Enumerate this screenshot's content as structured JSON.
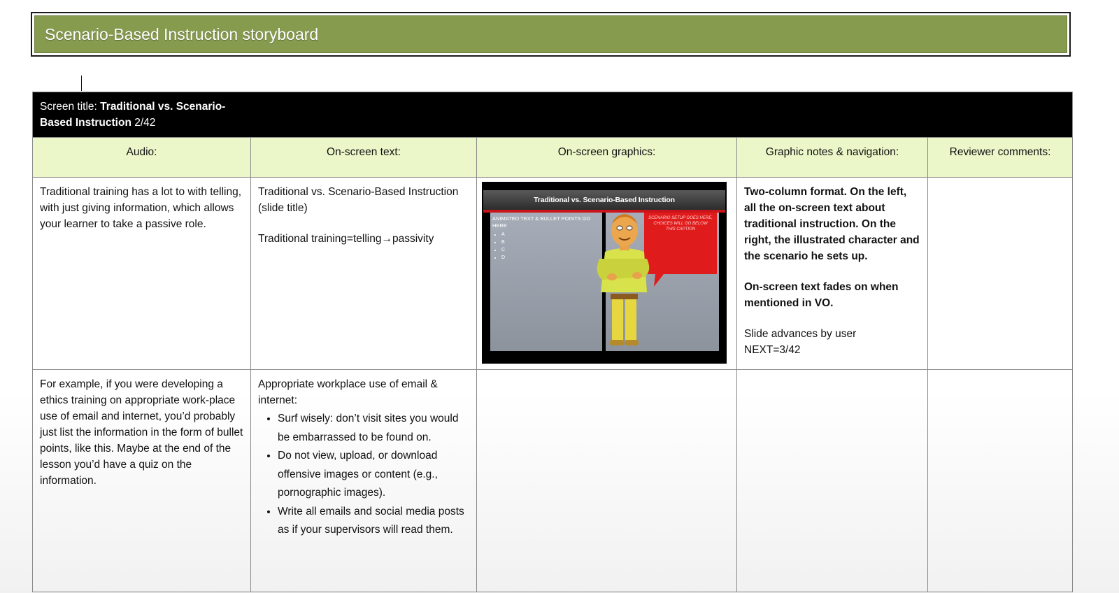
{
  "header": {
    "title": "Scenario-Based Instruction storyboard"
  },
  "screen": {
    "label": "Screen title:",
    "title_line1": "Traditional vs. Scenario-",
    "title_line2": "Based Instruction",
    "counter": "2/42"
  },
  "columns": [
    "Audio:",
    "On-screen text:",
    "On-screen graphics:",
    "Graphic notes & navigation:",
    "Reviewer comments:"
  ],
  "rows": [
    {
      "audio": "Traditional training has a lot to with telling, with just giving information, which allows your learner to take a passive role.",
      "onscreen_text_line1": "Traditional vs. Scenario-Based Instruction (slide title)",
      "onscreen_text_line2": "Traditional training=telling→passivity",
      "graphic": {
        "slide_title": "Traditional vs. Scenario-Based Instruction",
        "left_heading": "ANIMATED TEXT & BULLET POINTS GO HERE",
        "bullets": [
          "A",
          "B",
          "C",
          "D"
        ],
        "bubble_text": "SCENARIO SETUP GOES HERE, CHOICES WILL GO BELOW THIS CAPTION"
      },
      "notes_bold_1": "Two-column format. On the left, all the on-screen text about traditional instruction. On the right, the illustrated  character and the scenario he sets up.",
      "notes_bold_2": "On-screen text fades on when mentioned in VO.",
      "notes_plain_1": "Slide advances by user",
      "notes_plain_2": "NEXT=3/42",
      "reviewer": ""
    },
    {
      "audio": "For example, if you were developing a ethics training on appropriate work-place use of email and internet, you’d probably just list the information in the form of bullet points, like this. Maybe at the end of the lesson you’d have a quiz on the information.",
      "onscreen_intro": "Appropriate  workplace use of email & internet:",
      "onscreen_bullets": [
        "Surf wisely: don’t visit sites you would be embarrassed to be found on.",
        "Do not view, upload, or download offensive images or content (e.g., pornographic images).",
        "Write all emails and social media posts as if your supervisors will read them."
      ],
      "reviewer": ""
    }
  ],
  "colors": {
    "header_green": "#879b4f",
    "column_header_bg": "#ebf7c9",
    "title_row_bg": "#000000",
    "slide_accent_red": "#c8141a"
  }
}
